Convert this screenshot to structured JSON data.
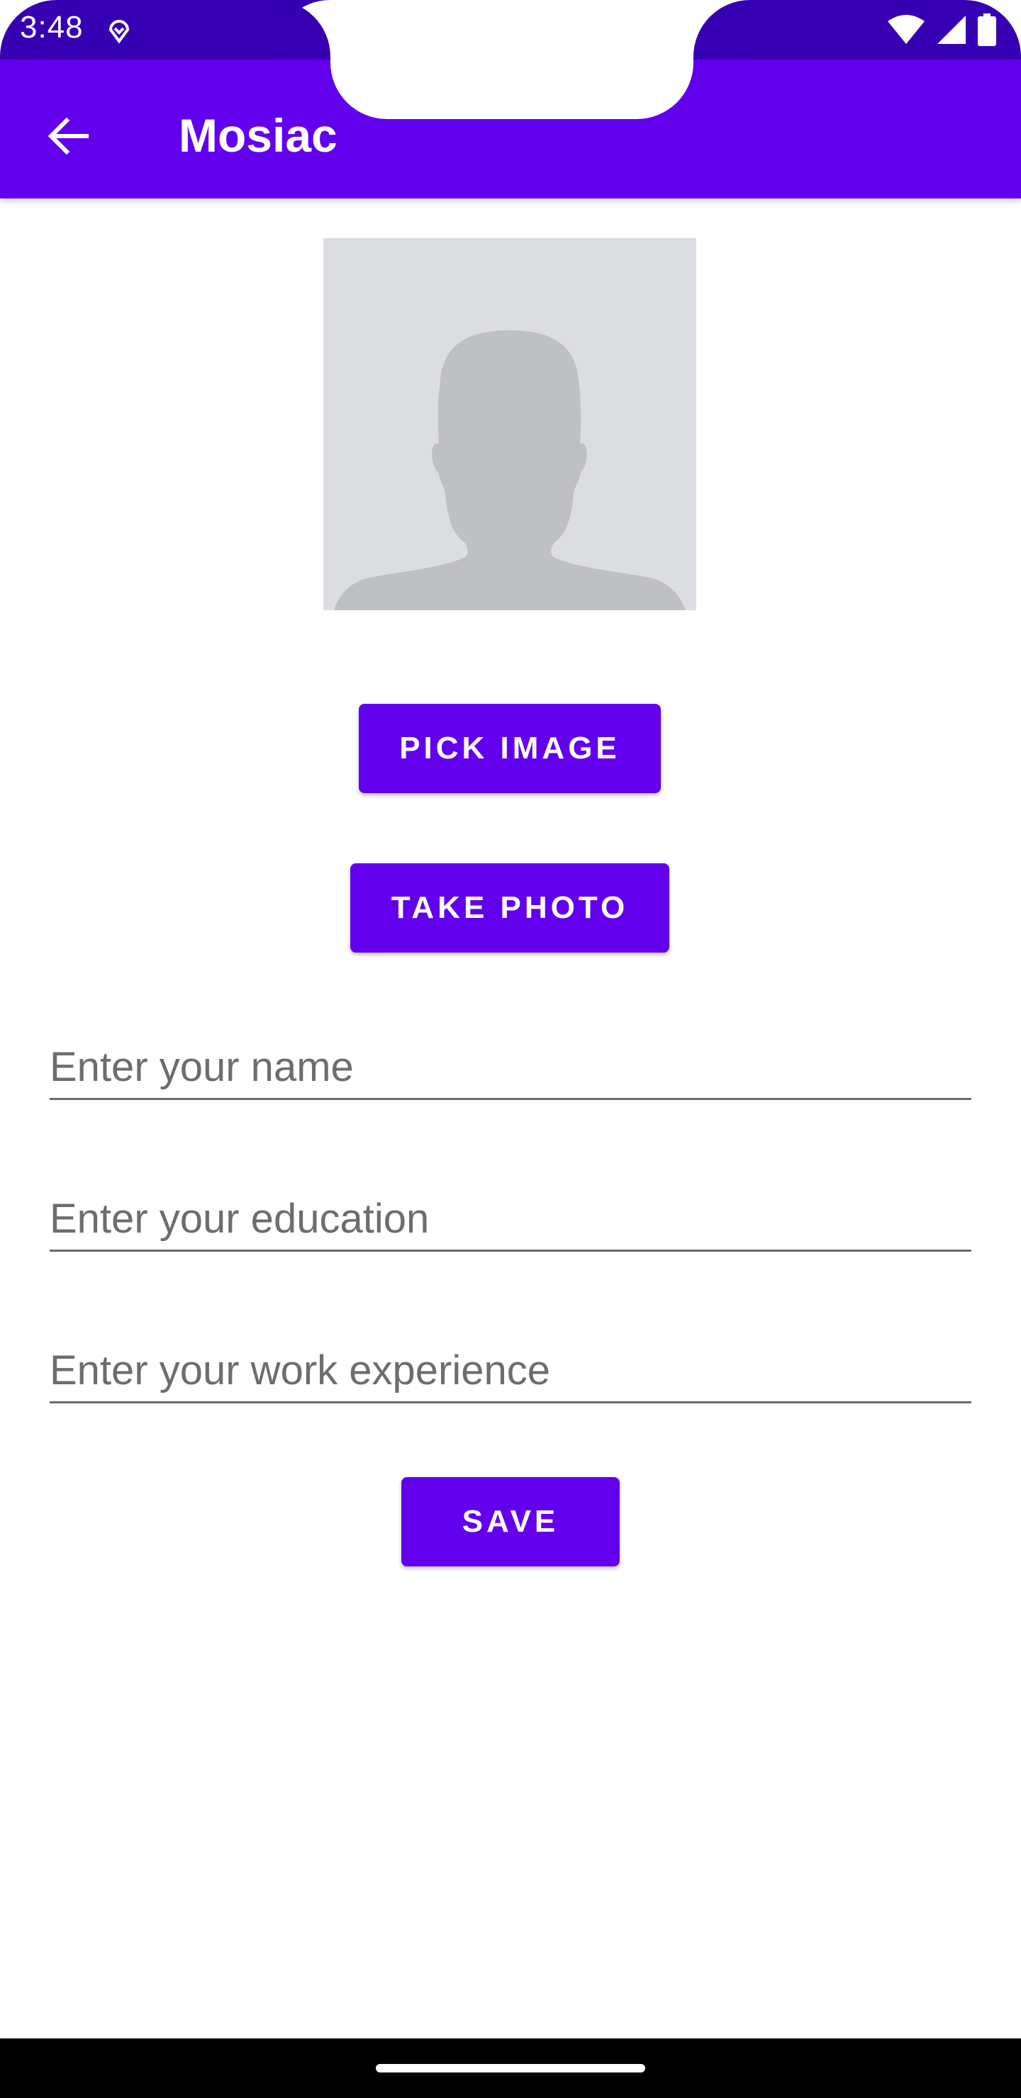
{
  "status_bar": {
    "time": "3:48",
    "notification_icon": "location-pin-icon",
    "icons": [
      "wifi-icon",
      "cell-signal-icon",
      "battery-icon"
    ]
  },
  "app_bar": {
    "back_icon": "arrow-back-icon",
    "title": "Mosiac"
  },
  "profile": {
    "placeholder_icon": "person-silhouette-icon"
  },
  "buttons": {
    "pick_image": "PICK IMAGE",
    "take_photo": "TAKE PHOTO",
    "save": "SAVE"
  },
  "form": {
    "name_placeholder": "Enter your name",
    "name_value": "",
    "education_placeholder": "Enter your education",
    "education_value": "",
    "experience_placeholder": "Enter your work experience",
    "experience_value": ""
  },
  "colors": {
    "status_bar": "#3700b3",
    "primary": "#6200ee",
    "image_background": "#dcdde0",
    "silhouette": "#bfc0c3"
  }
}
